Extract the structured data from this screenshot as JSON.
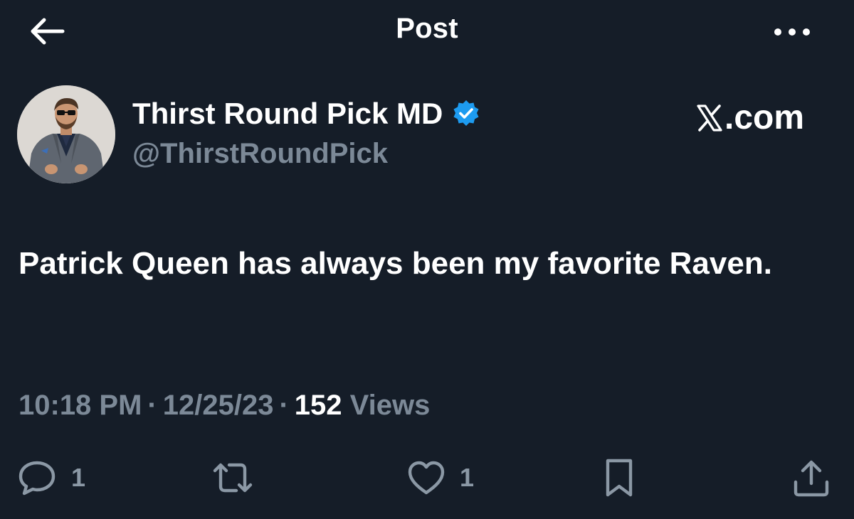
{
  "header": {
    "title": "Post",
    "back_icon": "arrow-left-icon",
    "more_icon": "more-horizontal-icon"
  },
  "author": {
    "name": "Thirst Round Pick MD",
    "handle": "@ThirstRoundPick",
    "verified": true,
    "verified_color": "#1d9bf0"
  },
  "source": {
    "label": ".com",
    "logo_icon": "x-logo-icon"
  },
  "post": {
    "text": "Patrick Queen has always been my favorite Raven."
  },
  "meta": {
    "time": "10:18 PM",
    "date": "12/25/23",
    "separator": "·",
    "views_count": "152",
    "views_label": "Views"
  },
  "actions": {
    "reply_count": "1",
    "like_count": "1"
  },
  "colors": {
    "background": "#151d28",
    "primary_text": "#ffffff",
    "secondary_text": "#7c8997",
    "icon": "#8b98a5"
  }
}
